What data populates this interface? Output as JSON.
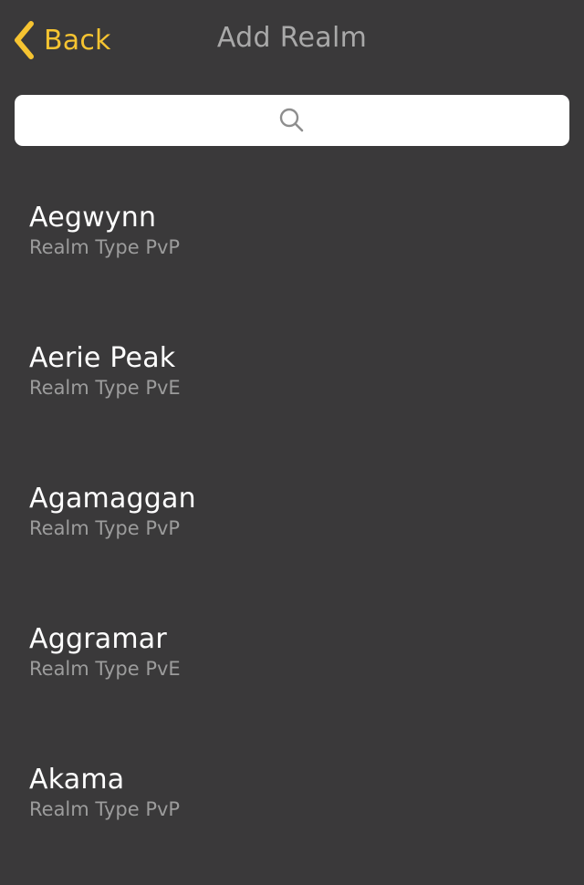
{
  "nav": {
    "back_label": "Back",
    "title": "Add Realm"
  },
  "search": {
    "placeholder": "",
    "icon": "search-icon"
  },
  "realms": [
    {
      "name": "Aegwynn",
      "type": "Realm Type PvP"
    },
    {
      "name": "Aerie Peak",
      "type": "Realm Type PvE"
    },
    {
      "name": "Agamaggan",
      "type": "Realm Type PvP"
    },
    {
      "name": "Aggramar",
      "type": "Realm Type PvE"
    },
    {
      "name": "Akama",
      "type": "Realm Type PvP"
    }
  ],
  "colors": {
    "background": "#3a393a",
    "accent": "#f6c431",
    "title": "#a9a9a9",
    "primary_text": "#ffffff",
    "secondary_text": "#9c9c9c"
  }
}
